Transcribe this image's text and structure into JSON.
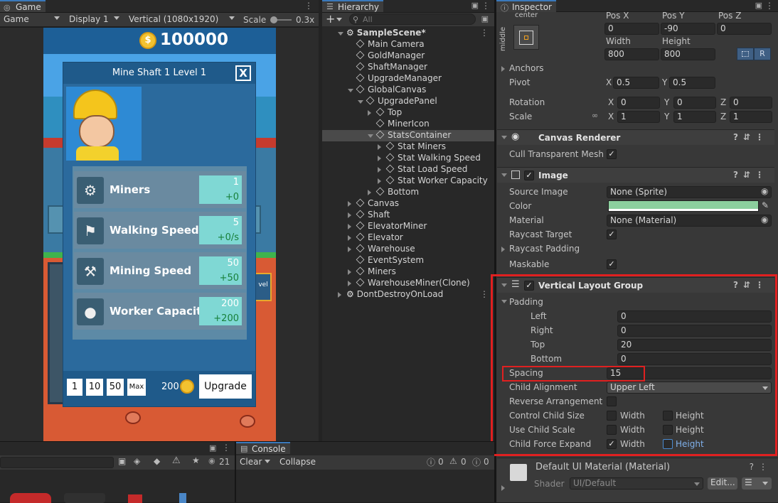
{
  "game": {
    "tab": "Game",
    "display_mode": "Game",
    "display": "Display 1",
    "resolution": "Vertical (1080x1920)",
    "scale_label": "Scale",
    "scale_value": "0.3x",
    "gold": "100000",
    "panel_title": "Mine Shaft 1 Level 1",
    "close_label": "X",
    "stats": [
      {
        "name": "Miners",
        "value": "1",
        "delta": "+0",
        "icon": "miner-icon"
      },
      {
        "name": "Walking Speed",
        "value": "5",
        "delta": "+0/s",
        "icon": "boot-icon"
      },
      {
        "name": "Mining Speed",
        "value": "50",
        "delta": "+50",
        "icon": "pickaxe-icon"
      },
      {
        "name": "Worker Capacity",
        "value": "200",
        "delta": "+200",
        "icon": "sack-icon"
      }
    ],
    "multipliers": [
      "1",
      "10",
      "50",
      "Max"
    ],
    "cost": "200",
    "upgrade_label": "Upgrade",
    "level_badge": "vel"
  },
  "hierarchy": {
    "tab": "Hierarchy",
    "search_placeholder": "All",
    "items": [
      {
        "label": "SampleScene*",
        "depth": 0,
        "expander": "open",
        "icon": "unity-scene-icon",
        "bold": true
      },
      {
        "label": "Main Camera",
        "depth": 1,
        "expander": "none",
        "icon": "gameobject-icon"
      },
      {
        "label": "GoldManager",
        "depth": 1,
        "expander": "none",
        "icon": "gameobject-icon"
      },
      {
        "label": "ShaftManager",
        "depth": 1,
        "expander": "none",
        "icon": "gameobject-icon"
      },
      {
        "label": "UpgradeManager",
        "depth": 1,
        "expander": "none",
        "icon": "gameobject-icon"
      },
      {
        "label": "GlobalCanvas",
        "depth": 1,
        "expander": "open",
        "icon": "gameobject-icon"
      },
      {
        "label": "UpgradePanel",
        "depth": 2,
        "expander": "open",
        "icon": "gameobject-icon"
      },
      {
        "label": "Top",
        "depth": 3,
        "expander": "closed",
        "icon": "gameobject-icon"
      },
      {
        "label": "MinerIcon",
        "depth": 3,
        "expander": "none",
        "icon": "gameobject-icon"
      },
      {
        "label": "StatsContainer",
        "depth": 3,
        "expander": "open",
        "icon": "gameobject-icon",
        "selected": true
      },
      {
        "label": "Stat Miners",
        "depth": 4,
        "expander": "closed",
        "icon": "gameobject-icon"
      },
      {
        "label": "Stat Walking Speed",
        "depth": 4,
        "expander": "closed",
        "icon": "gameobject-icon"
      },
      {
        "label": "Stat Load Speed",
        "depth": 4,
        "expander": "closed",
        "icon": "gameobject-icon"
      },
      {
        "label": "Stat Worker Capacity",
        "depth": 4,
        "expander": "closed",
        "icon": "gameobject-icon"
      },
      {
        "label": "Bottom",
        "depth": 3,
        "expander": "closed",
        "icon": "gameobject-icon"
      },
      {
        "label": "Canvas",
        "depth": 1,
        "expander": "closed",
        "icon": "gameobject-icon"
      },
      {
        "label": "Shaft",
        "depth": 1,
        "expander": "closed",
        "icon": "gameobject-icon"
      },
      {
        "label": "ElevatorMiner",
        "depth": 1,
        "expander": "closed",
        "icon": "gameobject-icon"
      },
      {
        "label": "Elevator",
        "depth": 1,
        "expander": "closed",
        "icon": "gameobject-icon"
      },
      {
        "label": "Warehouse",
        "depth": 1,
        "expander": "closed",
        "icon": "gameobject-icon"
      },
      {
        "label": "EventSystem",
        "depth": 1,
        "expander": "none",
        "icon": "gameobject-icon"
      },
      {
        "label": "Miners",
        "depth": 1,
        "expander": "closed",
        "icon": "gameobject-icon"
      },
      {
        "label": "WarehouseMiner(Clone)",
        "depth": 1,
        "expander": "closed",
        "icon": "gameobject-icon"
      },
      {
        "label": "DontDestroyOnLoad",
        "depth": 0,
        "expander": "closed",
        "icon": "unity-scene-icon"
      }
    ]
  },
  "inspector": {
    "tab": "Inspector",
    "anchor_preset": {
      "h": "center",
      "v": "middle"
    },
    "pos_x_label": "Pos X",
    "pos_y_label": "Pos Y",
    "pos_z_label": "Pos Z",
    "pos_x": "0",
    "pos_y": "-90",
    "pos_z": "0",
    "width_label": "Width",
    "height_label": "Height",
    "width": "800",
    "height": "800",
    "r_button": "R",
    "anchors_label": "Anchors",
    "pivot_label": "Pivot",
    "pivot_x": "0.5",
    "pivot_y": "0.5",
    "rotation_label": "Rotation",
    "rot_x": "0",
    "rot_y": "0",
    "rot_z": "0",
    "scale_label": "Scale",
    "scale_x": "1",
    "scale_y": "1",
    "scale_z": "1",
    "axis_x": "X",
    "axis_y": "Y",
    "axis_z": "Z",
    "canvas_renderer": {
      "title": "Canvas Renderer",
      "cull_label": "Cull Transparent Mesh",
      "cull": true
    },
    "image": {
      "title": "Image",
      "source_image_label": "Source Image",
      "source_image": "None (Sprite)",
      "color_label": "Color",
      "color": "#8ccf9e",
      "material_label": "Material",
      "material": "None (Material)",
      "raycast_target_label": "Raycast Target",
      "raycast_target": true,
      "raycast_padding_label": "Raycast Padding",
      "maskable_label": "Maskable",
      "maskable": true
    },
    "vlg": {
      "title": "Vertical Layout Group",
      "padding_label": "Padding",
      "left_label": "Left",
      "left": "0",
      "right_label": "Right",
      "right": "0",
      "top_label": "Top",
      "top": "20",
      "bottom_label": "Bottom",
      "bottom": "0",
      "spacing_label": "Spacing",
      "spacing": "15",
      "child_alignment_label": "Child Alignment",
      "child_alignment": "Upper Left",
      "reverse_label": "Reverse Arrangement",
      "control_size_label": "Control Child Size",
      "use_scale_label": "Use Child Scale",
      "force_expand_label": "Child Force Expand",
      "width_label": "Width",
      "height_label": "Height",
      "highlight_color": "#e02020"
    },
    "material_section": {
      "title": "Default UI Material (Material)",
      "shader_label": "Shader",
      "shader": "UI/Default",
      "edit_label": "Edit..."
    }
  },
  "project": {
    "count": "21"
  },
  "console": {
    "tab": "Console",
    "clear_label": "Clear",
    "collapse_label": "Collapse",
    "errors": "0",
    "warnings": "0",
    "logs": "0"
  }
}
